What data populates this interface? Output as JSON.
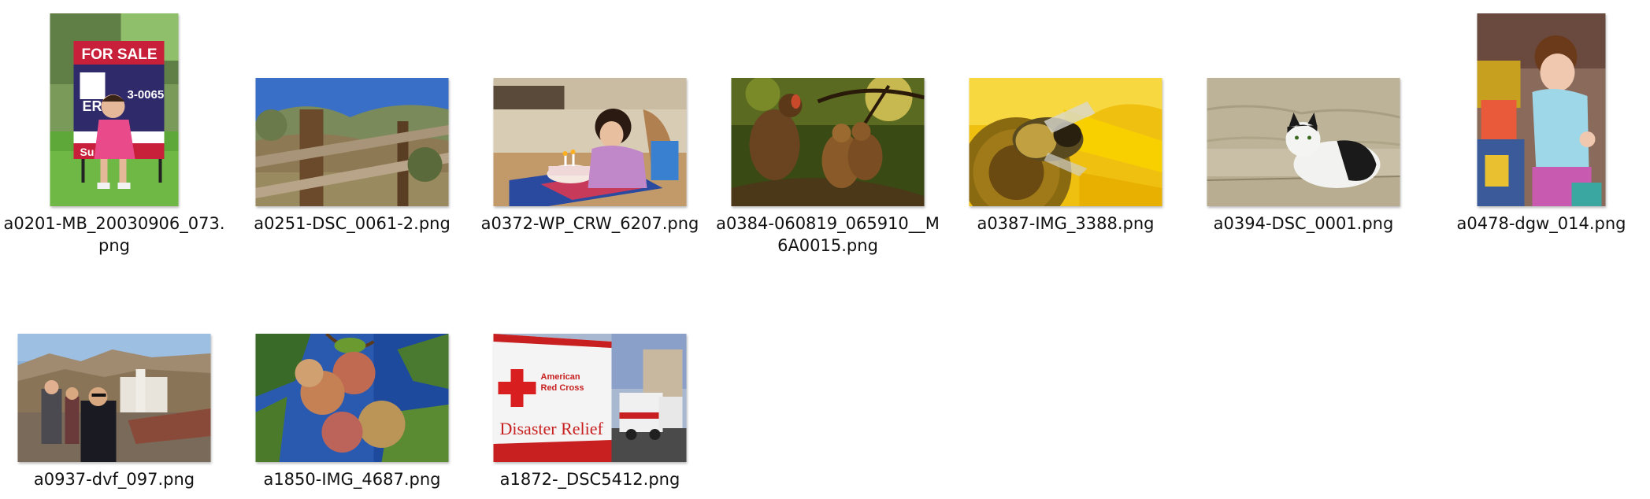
{
  "explorer": {
    "view": "large-icons",
    "files": [
      {
        "name": "a0201-MB_20030906_073.png",
        "orientation": "portrait",
        "icon": "image-file-icon"
      },
      {
        "name": "a0251-DSC_0061-2.png",
        "orientation": "landscape",
        "icon": "image-file-icon"
      },
      {
        "name": "a0372-WP_CRW_6207.png",
        "orientation": "landscape",
        "icon": "image-file-icon"
      },
      {
        "name": "a0384-060819_065910__M6A0015.png",
        "orientation": "landscape",
        "icon": "image-file-icon"
      },
      {
        "name": "a0387-IMG_3388.png",
        "orientation": "landscape",
        "icon": "image-file-icon"
      },
      {
        "name": "a0394-DSC_0001.png",
        "orientation": "landscape",
        "icon": "image-file-icon"
      },
      {
        "name": "a0478-dgw_014.png",
        "orientation": "portrait",
        "icon": "image-file-icon"
      },
      {
        "name": "a0937-dvf_097.png",
        "orientation": "landscape",
        "icon": "image-file-icon"
      },
      {
        "name": "a1850-IMG_4687.png",
        "orientation": "landscape",
        "icon": "image-file-icon"
      },
      {
        "name": "a1872-_DSC5412.png",
        "orientation": "landscape",
        "icon": "image-file-icon"
      }
    ]
  },
  "thumbnails": {
    "sign_text_top": "FOR SALE",
    "sign_text_mid": "ER",
    "sign_text_phone": "3-0065",
    "sign_text_bottom": "Su",
    "cross_text_1": "American",
    "cross_text_2": "Red Cross",
    "cross_text_3": "Disaster Relief"
  }
}
